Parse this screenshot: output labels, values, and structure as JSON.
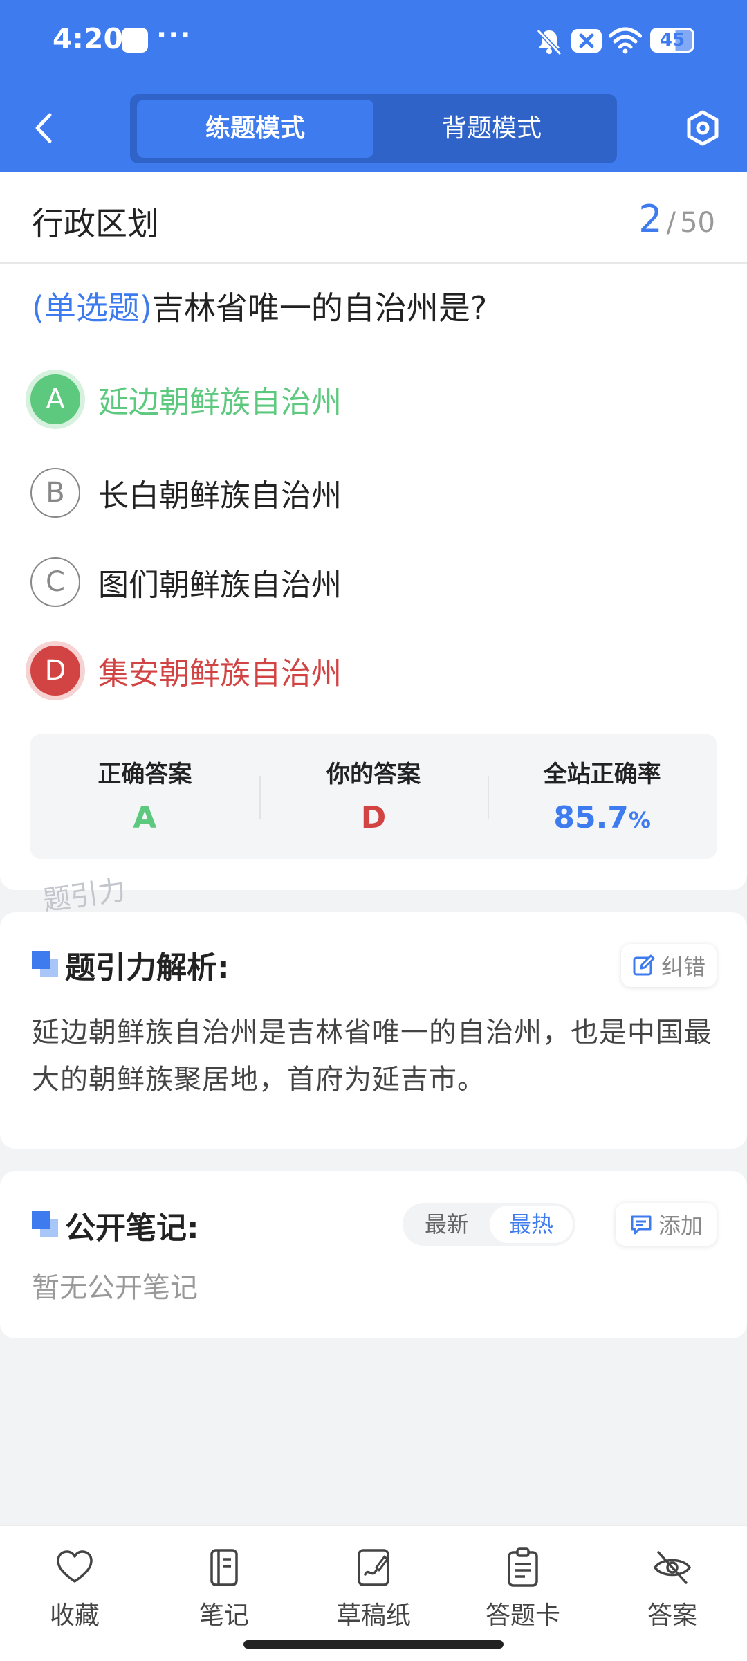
{
  "status_bar": {
    "time": "4:20",
    "dots": "···",
    "battery": "45"
  },
  "nav": {
    "modes": [
      "练题模式",
      "背题模式"
    ],
    "active_mode": "练题模式"
  },
  "question_card": {
    "section_title": "行政区划",
    "progress_current": "2",
    "progress_separator": "/",
    "progress_total": "50",
    "question_type": "(单选题)",
    "question_text": "吉林省唯一的自治州是?",
    "options": [
      {
        "letter": "A",
        "text": "延边朝鲜族自治州",
        "state": "correct"
      },
      {
        "letter": "B",
        "text": "长白朝鲜族自治州",
        "state": "normal"
      },
      {
        "letter": "C",
        "text": "图们朝鲜族自治州",
        "state": "normal"
      },
      {
        "letter": "D",
        "text": "集安朝鲜族自治州",
        "state": "wrong"
      }
    ],
    "summary": {
      "correct_label": "正确答案",
      "correct_value": "A",
      "yours_label": "你的答案",
      "yours_value": "D",
      "rate_label": "全站正确率",
      "rate_value": "85.7",
      "rate_unit": "%"
    }
  },
  "watermark": "题引力",
  "analysis": {
    "title": "题引力解析:",
    "report_label": "纠错",
    "text": "延边朝鲜族自治州是吉林省唯一的自治州，也是中国最大的朝鲜族聚居地，首府为延吉市。"
  },
  "notes": {
    "title": "公开笔记:",
    "sort_latest": "最新",
    "sort_hot": "最热",
    "add_label": "添加",
    "empty_text": "暂无公开笔记"
  },
  "bottom_nav": [
    {
      "label": "收藏",
      "icon": "heart-icon"
    },
    {
      "label": "笔记",
      "icon": "notebook-icon"
    },
    {
      "label": "草稿纸",
      "icon": "draft-icon"
    },
    {
      "label": "答题卡",
      "icon": "answer-sheet-icon"
    },
    {
      "label": "答案",
      "icon": "eye-off-icon"
    }
  ],
  "colors": {
    "primary": "#3d7bef",
    "correct": "#5cc97e",
    "wrong": "#d24343",
    "background": "#f2f3f5"
  }
}
